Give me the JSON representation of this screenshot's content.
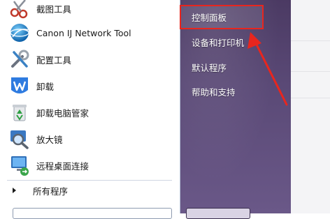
{
  "start_menu": {
    "programs": [
      {
        "label": "截图工具",
        "icon": "snipping-tool-icon"
      },
      {
        "label": "Canon IJ Network Tool",
        "icon": "network-globe-icon"
      },
      {
        "label": "配置工具",
        "icon": "config-tools-icon"
      },
      {
        "label": "卸载",
        "icon": "wps-icon"
      },
      {
        "label": "卸载电脑管家",
        "icon": "recycle-icon"
      },
      {
        "label": "放大镜",
        "icon": "magnifier-icon"
      },
      {
        "label": "远程桌面连接",
        "icon": "remote-desktop-icon"
      }
    ],
    "all_programs_label": "所有程序",
    "right_items": [
      {
        "label": "控制面板"
      },
      {
        "label": "设备和打印机"
      },
      {
        "label": "默认程序"
      },
      {
        "label": "帮助和支持"
      }
    ]
  },
  "annotation": {
    "color": "#e8261e",
    "highlighted_item": "控制面板"
  }
}
